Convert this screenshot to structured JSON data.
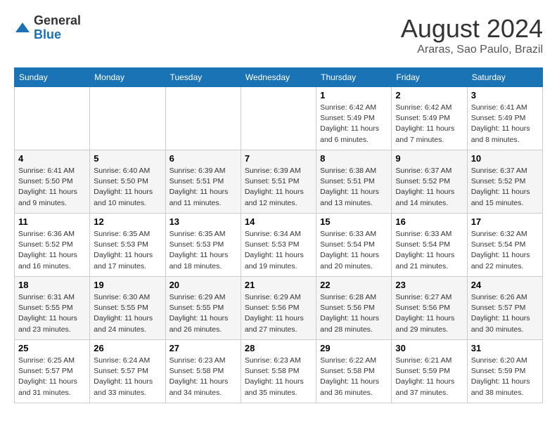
{
  "header": {
    "logo_general": "General",
    "logo_blue": "Blue",
    "month_title": "August 2024",
    "location": "Araras, Sao Paulo, Brazil"
  },
  "weekdays": [
    "Sunday",
    "Monday",
    "Tuesday",
    "Wednesday",
    "Thursday",
    "Friday",
    "Saturday"
  ],
  "weeks": [
    [
      {
        "day": "",
        "info": ""
      },
      {
        "day": "",
        "info": ""
      },
      {
        "day": "",
        "info": ""
      },
      {
        "day": "",
        "info": ""
      },
      {
        "day": "1",
        "info": "Sunrise: 6:42 AM\nSunset: 5:49 PM\nDaylight: 11 hours\nand 6 minutes."
      },
      {
        "day": "2",
        "info": "Sunrise: 6:42 AM\nSunset: 5:49 PM\nDaylight: 11 hours\nand 7 minutes."
      },
      {
        "day": "3",
        "info": "Sunrise: 6:41 AM\nSunset: 5:49 PM\nDaylight: 11 hours\nand 8 minutes."
      }
    ],
    [
      {
        "day": "4",
        "info": "Sunrise: 6:41 AM\nSunset: 5:50 PM\nDaylight: 11 hours\nand 9 minutes."
      },
      {
        "day": "5",
        "info": "Sunrise: 6:40 AM\nSunset: 5:50 PM\nDaylight: 11 hours\nand 10 minutes."
      },
      {
        "day": "6",
        "info": "Sunrise: 6:39 AM\nSunset: 5:51 PM\nDaylight: 11 hours\nand 11 minutes."
      },
      {
        "day": "7",
        "info": "Sunrise: 6:39 AM\nSunset: 5:51 PM\nDaylight: 11 hours\nand 12 minutes."
      },
      {
        "day": "8",
        "info": "Sunrise: 6:38 AM\nSunset: 5:51 PM\nDaylight: 11 hours\nand 13 minutes."
      },
      {
        "day": "9",
        "info": "Sunrise: 6:37 AM\nSunset: 5:52 PM\nDaylight: 11 hours\nand 14 minutes."
      },
      {
        "day": "10",
        "info": "Sunrise: 6:37 AM\nSunset: 5:52 PM\nDaylight: 11 hours\nand 15 minutes."
      }
    ],
    [
      {
        "day": "11",
        "info": "Sunrise: 6:36 AM\nSunset: 5:52 PM\nDaylight: 11 hours\nand 16 minutes."
      },
      {
        "day": "12",
        "info": "Sunrise: 6:35 AM\nSunset: 5:53 PM\nDaylight: 11 hours\nand 17 minutes."
      },
      {
        "day": "13",
        "info": "Sunrise: 6:35 AM\nSunset: 5:53 PM\nDaylight: 11 hours\nand 18 minutes."
      },
      {
        "day": "14",
        "info": "Sunrise: 6:34 AM\nSunset: 5:53 PM\nDaylight: 11 hours\nand 19 minutes."
      },
      {
        "day": "15",
        "info": "Sunrise: 6:33 AM\nSunset: 5:54 PM\nDaylight: 11 hours\nand 20 minutes."
      },
      {
        "day": "16",
        "info": "Sunrise: 6:33 AM\nSunset: 5:54 PM\nDaylight: 11 hours\nand 21 minutes."
      },
      {
        "day": "17",
        "info": "Sunrise: 6:32 AM\nSunset: 5:54 PM\nDaylight: 11 hours\nand 22 minutes."
      }
    ],
    [
      {
        "day": "18",
        "info": "Sunrise: 6:31 AM\nSunset: 5:55 PM\nDaylight: 11 hours\nand 23 minutes."
      },
      {
        "day": "19",
        "info": "Sunrise: 6:30 AM\nSunset: 5:55 PM\nDaylight: 11 hours\nand 24 minutes."
      },
      {
        "day": "20",
        "info": "Sunrise: 6:29 AM\nSunset: 5:55 PM\nDaylight: 11 hours\nand 26 minutes."
      },
      {
        "day": "21",
        "info": "Sunrise: 6:29 AM\nSunset: 5:56 PM\nDaylight: 11 hours\nand 27 minutes."
      },
      {
        "day": "22",
        "info": "Sunrise: 6:28 AM\nSunset: 5:56 PM\nDaylight: 11 hours\nand 28 minutes."
      },
      {
        "day": "23",
        "info": "Sunrise: 6:27 AM\nSunset: 5:56 PM\nDaylight: 11 hours\nand 29 minutes."
      },
      {
        "day": "24",
        "info": "Sunrise: 6:26 AM\nSunset: 5:57 PM\nDaylight: 11 hours\nand 30 minutes."
      }
    ],
    [
      {
        "day": "25",
        "info": "Sunrise: 6:25 AM\nSunset: 5:57 PM\nDaylight: 11 hours\nand 31 minutes."
      },
      {
        "day": "26",
        "info": "Sunrise: 6:24 AM\nSunset: 5:57 PM\nDaylight: 11 hours\nand 33 minutes."
      },
      {
        "day": "27",
        "info": "Sunrise: 6:23 AM\nSunset: 5:58 PM\nDaylight: 11 hours\nand 34 minutes."
      },
      {
        "day": "28",
        "info": "Sunrise: 6:23 AM\nSunset: 5:58 PM\nDaylight: 11 hours\nand 35 minutes."
      },
      {
        "day": "29",
        "info": "Sunrise: 6:22 AM\nSunset: 5:58 PM\nDaylight: 11 hours\nand 36 minutes."
      },
      {
        "day": "30",
        "info": "Sunrise: 6:21 AM\nSunset: 5:59 PM\nDaylight: 11 hours\nand 37 minutes."
      },
      {
        "day": "31",
        "info": "Sunrise: 6:20 AM\nSunset: 5:59 PM\nDaylight: 11 hours\nand 38 minutes."
      }
    ]
  ]
}
